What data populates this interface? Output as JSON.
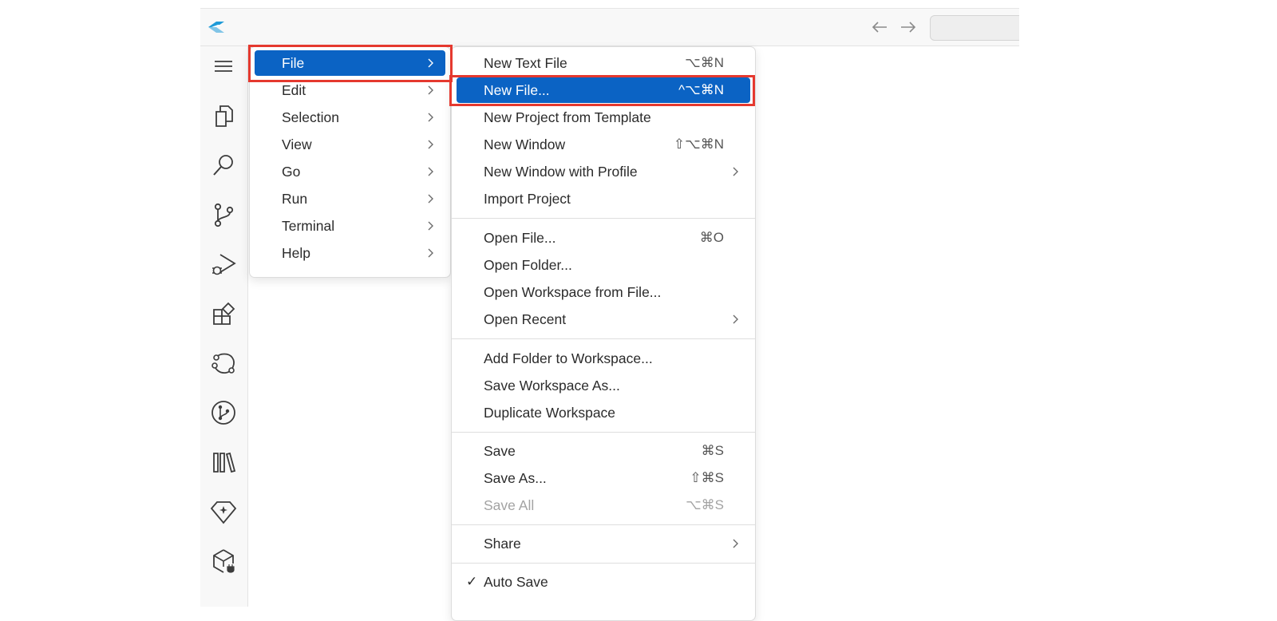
{
  "menubar": {
    "items": [
      {
        "label": "File"
      },
      {
        "label": "Edit"
      },
      {
        "label": "Selection"
      },
      {
        "label": "View"
      },
      {
        "label": "Go"
      },
      {
        "label": "Run"
      },
      {
        "label": "Terminal"
      },
      {
        "label": "Help"
      }
    ],
    "selected": "File"
  },
  "file_menu": {
    "items": [
      {
        "label": "New Text File",
        "shortcut": "⌥⌘N"
      },
      {
        "label": "New File...",
        "shortcut": "^⌥⌘N"
      },
      {
        "label": "New Project from Template",
        "shortcut": ""
      },
      {
        "label": "New Window",
        "shortcut": "⇧⌥⌘N"
      },
      {
        "label": "New Window with Profile",
        "shortcut": ""
      },
      {
        "label": "Import Project",
        "shortcut": ""
      },
      {
        "label": "Open File...",
        "shortcut": "⌘O"
      },
      {
        "label": "Open Folder...",
        "shortcut": ""
      },
      {
        "label": "Open Workspace from File...",
        "shortcut": ""
      },
      {
        "label": "Open Recent",
        "shortcut": ""
      },
      {
        "label": "Add Folder to Workspace...",
        "shortcut": ""
      },
      {
        "label": "Save Workspace As...",
        "shortcut": ""
      },
      {
        "label": "Duplicate Workspace",
        "shortcut": ""
      },
      {
        "label": "Save",
        "shortcut": "⌘S"
      },
      {
        "label": "Save As...",
        "shortcut": "⇧⌘S"
      },
      {
        "label": "Save All",
        "shortcut": "⌥⌘S"
      },
      {
        "label": "Share",
        "shortcut": ""
      },
      {
        "label": "Auto Save",
        "shortcut": "",
        "check": "✓"
      }
    ],
    "selected": "New File...",
    "disabled": [
      "Save All"
    ]
  },
  "colors": {
    "selection": "#0b63c4",
    "highlight_box": "#e5392f",
    "logo": "#1f9bd8"
  },
  "icons": {
    "activity_bar": [
      "menu-icon",
      "explorer-icon",
      "search-icon",
      "source-control-icon",
      "run-debug-icon",
      "extensions-icon",
      "remote-icon",
      "git-graph-icon",
      "library-icon",
      "gem-icon",
      "package-icon"
    ],
    "titlebar": [
      "app-logo-icon",
      "back-arrow-icon",
      "forward-arrow-icon"
    ]
  }
}
